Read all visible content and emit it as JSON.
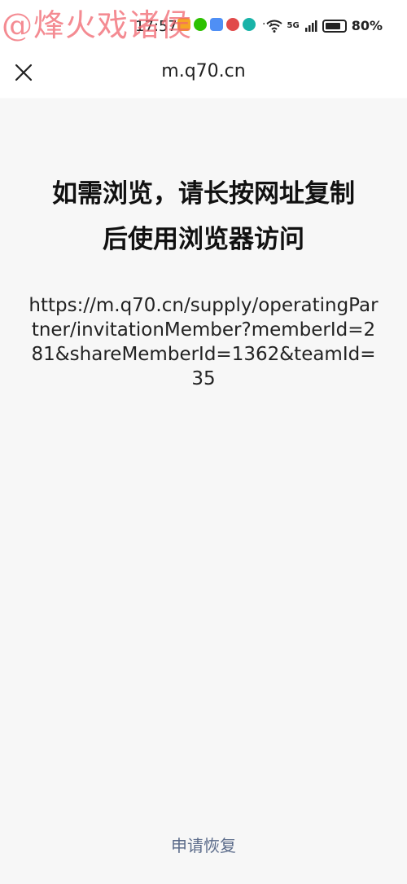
{
  "watermark": {
    "text": "@烽火戏诸侯"
  },
  "status_bar": {
    "time": "17:57",
    "signal_label": "5G",
    "battery": "80%",
    "app_icons": [
      {
        "name": "app-orange-icon",
        "color": "#f5a623"
      },
      {
        "name": "wechat-icon",
        "color": "#2dc100"
      },
      {
        "name": "app-gallery-icon",
        "color": "#4f8ff5"
      },
      {
        "name": "app-red-icon",
        "color": "#e14a4a"
      },
      {
        "name": "chat-bubble-icon",
        "color": "#19b3a8"
      }
    ]
  },
  "titlebar": {
    "title": "m.q70.cn",
    "close_icon": "close-icon"
  },
  "main": {
    "heading_line1": "如需浏览，请长按网址复制",
    "heading_line2": "后使用浏览器访问",
    "url": "https://m.q70.cn/supply/operatingPartner/invitationMember?memberId=281&shareMemberId=1362&teamId=35"
  },
  "footer": {
    "link_label": "申请恢复"
  }
}
